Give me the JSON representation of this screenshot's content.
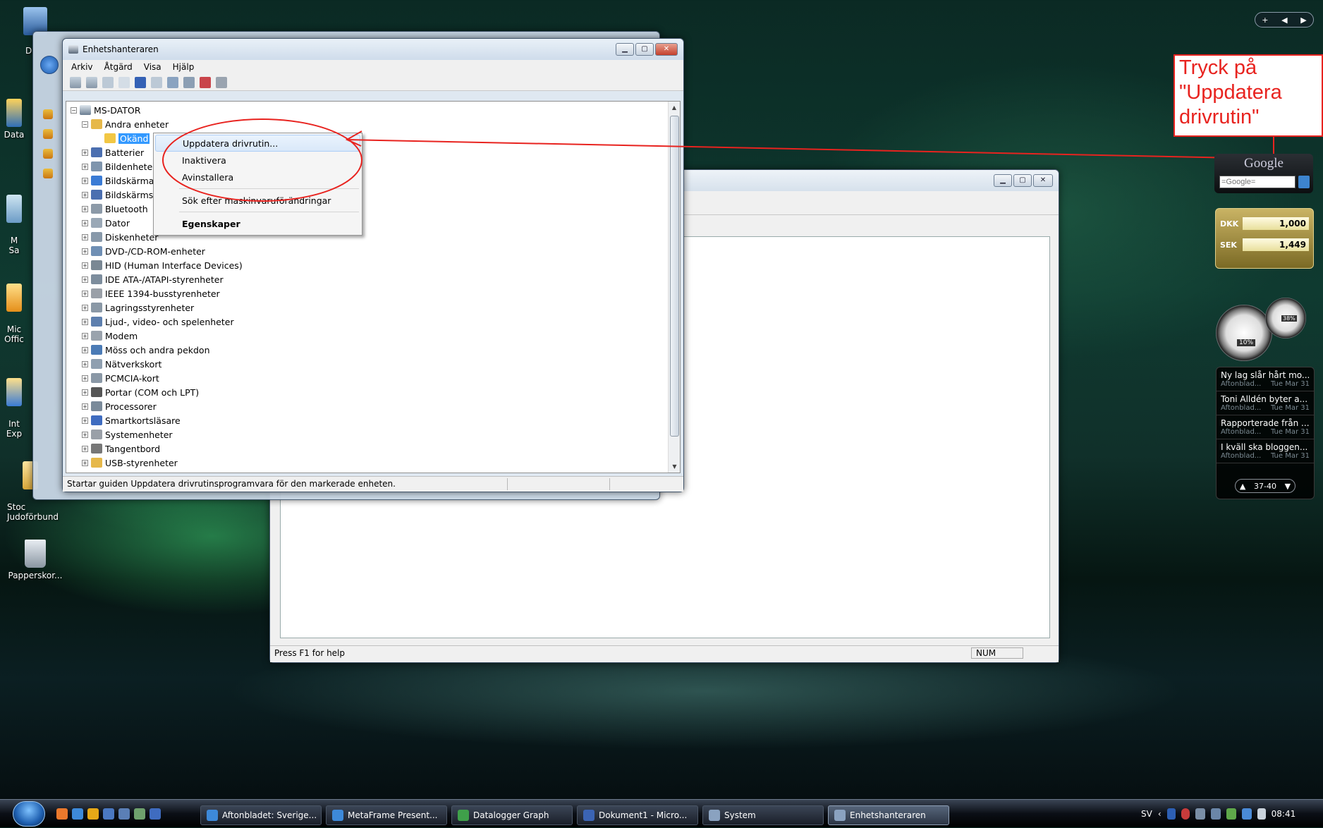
{
  "desktop": {
    "icons": [
      {
        "label": "D"
      },
      {
        "label": "Data"
      },
      {
        "label": "M\nSa"
      },
      {
        "label": "Mic\nOffic"
      },
      {
        "label": "Int\nExp"
      },
      {
        "label": "Stoc\nJudoförbund"
      },
      {
        "label": "Papperskor..."
      }
    ]
  },
  "devmgr": {
    "title": "Enhetshanteraren",
    "menu": [
      "Arkiv",
      "Åtgärd",
      "Visa",
      "Hjälp"
    ],
    "root": "MS-DATOR",
    "tree": [
      {
        "label": "Andra enheter",
        "expanded": true
      },
      {
        "label": "Okänd",
        "child": true
      },
      {
        "label": "Batterier"
      },
      {
        "label": "Bildenheter"
      },
      {
        "label": "Bildskärmar"
      },
      {
        "label": "Bildskärmskort"
      },
      {
        "label": "Bluetooth"
      },
      {
        "label": "Dator"
      },
      {
        "label": "Diskenheter"
      },
      {
        "label": "DVD-/CD-ROM-enheter"
      },
      {
        "label": "HID (Human Interface Devices)"
      },
      {
        "label": "IDE ATA-/ATAPI-styrenheter"
      },
      {
        "label": "IEEE 1394-busstyrenheter"
      },
      {
        "label": "Lagringsstyrenheter"
      },
      {
        "label": "Ljud-, video- och spelenheter"
      },
      {
        "label": "Modem"
      },
      {
        "label": "Möss och andra pekdon"
      },
      {
        "label": "Nätverkskort"
      },
      {
        "label": "PCMCIA-kort"
      },
      {
        "label": "Portar (COM och LPT)"
      },
      {
        "label": "Processorer"
      },
      {
        "label": "Smartkortsläsare"
      },
      {
        "label": "Systemenheter"
      },
      {
        "label": "Tangentbord"
      },
      {
        "label": "USB-styrenheter"
      }
    ],
    "status": "Startar guiden Uppdatera drivrutinsprogramvara för den markerade enheten."
  },
  "context_menu": {
    "items": [
      "Uppdatera drivrutin...",
      "Inaktivera",
      "Avinstallera"
    ],
    "scan": "Sök efter maskinvaruförändringar",
    "properties": "Egenskaper"
  },
  "bg_window": {
    "status_left": "Press F1 for help",
    "status_num": "NUM"
  },
  "callout": {
    "text": "Tryck på \"Uppdatera drivrutin\"",
    "color": "#e8231f"
  },
  "gadgets": {
    "search_placeholder": "=Google=",
    "google_logo": "Google",
    "currency": [
      {
        "code": "DKK",
        "value": "1,000"
      },
      {
        "code": "SEK",
        "value": "1,449"
      }
    ],
    "meter_cpu": "10%",
    "meter_mem": "38%",
    "news": [
      {
        "title": "Ny lag slår hårt mo...",
        "source": "Aftonblad...",
        "date": "Tue Mar 31"
      },
      {
        "title": "Toni Alldén byter a...",
        "source": "Aftonblad...",
        "date": "Tue Mar 31"
      },
      {
        "title": "Rapporterade från ...",
        "source": "Aftonblad...",
        "date": "Tue Mar 31"
      },
      {
        "title": "I kväll ska bloggen...",
        "source": "Aftonblad...",
        "date": "Tue Mar 31"
      }
    ],
    "news_pager": "37-40"
  },
  "taskbar": {
    "buttons": [
      {
        "label": "Aftonbladet: Sverige..."
      },
      {
        "label": "MetaFrame Present..."
      },
      {
        "label": "Datalogger Graph"
      },
      {
        "label": "Dokument1 - Micro..."
      },
      {
        "label": "System"
      },
      {
        "label": "Enhetshanteraren"
      }
    ],
    "lang": "SV",
    "clock": "08:41"
  }
}
